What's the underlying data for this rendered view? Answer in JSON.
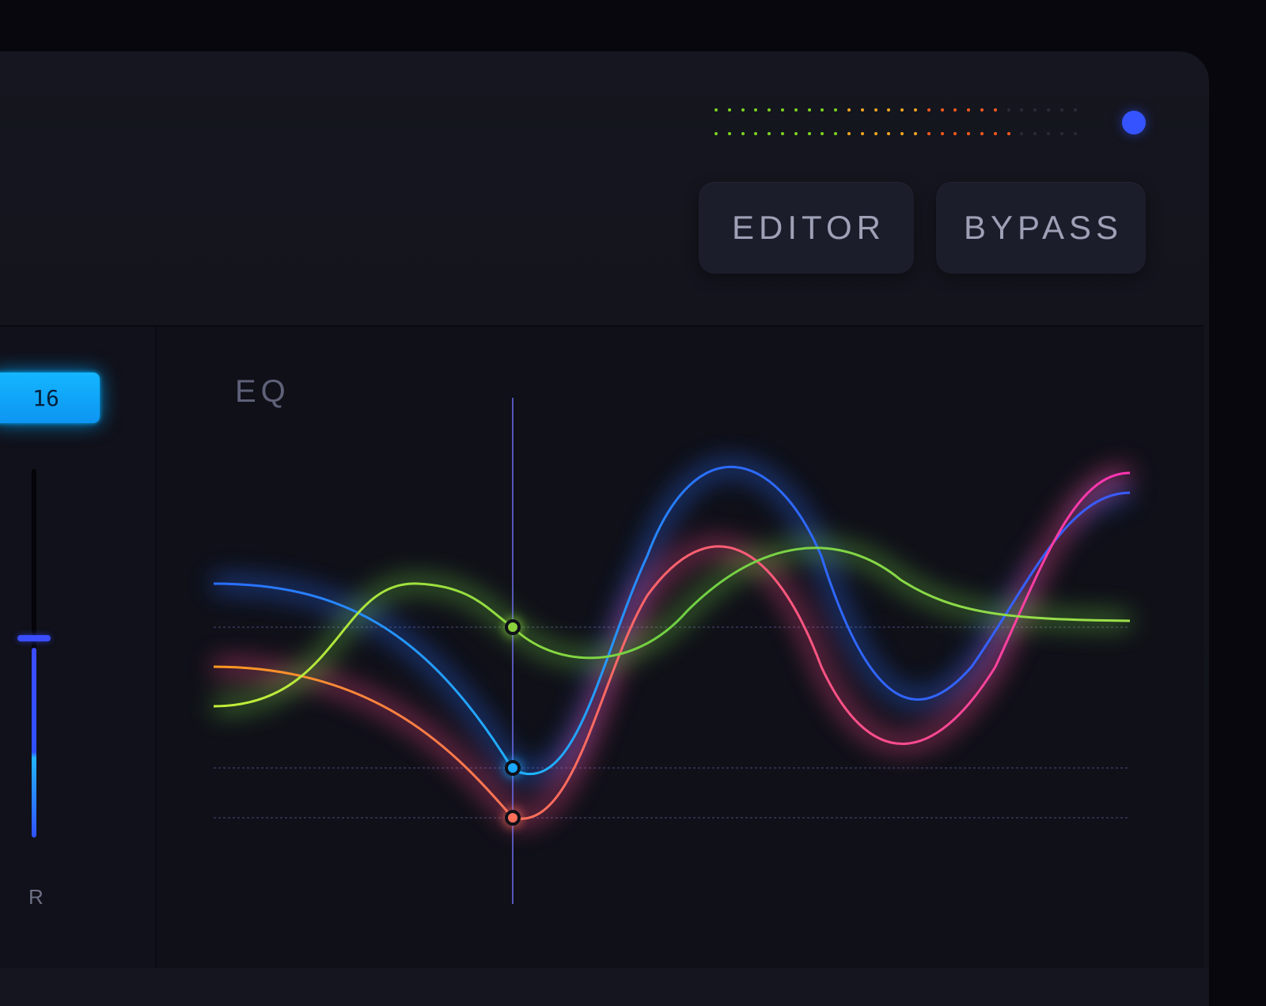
{
  "header": {
    "buttons": [
      {
        "label": "EDITOR"
      },
      {
        "label": "BYPASS"
      }
    ],
    "power_indicator_color": "#3554ff",
    "meters": {
      "dot_count": 28,
      "levels": [
        0.79,
        0.82
      ],
      "colors": {
        "low": "#7ed321",
        "mid": "#f5a623",
        "high": "#ff5a1f",
        "off": "#2a2b38"
      }
    }
  },
  "sidebar": {
    "value": "16",
    "slider_level": 0.54,
    "channel_label": "R"
  },
  "eq": {
    "title": "EQ",
    "cursor_line_color": "#6d6cf0",
    "curve_colors": {
      "blue": "#2a6cff",
      "cyan": "#20b4ff",
      "green": "#8bd13d",
      "orange": "#ff8a2a",
      "pink": "#ff3aa8",
      "salmon": "#ff6f5a"
    },
    "node_colors": [
      "#8bd13d",
      "#1aa8ff",
      "#ff6f5a"
    ],
    "bands": [
      "blue",
      "green",
      "orange"
    ]
  }
}
